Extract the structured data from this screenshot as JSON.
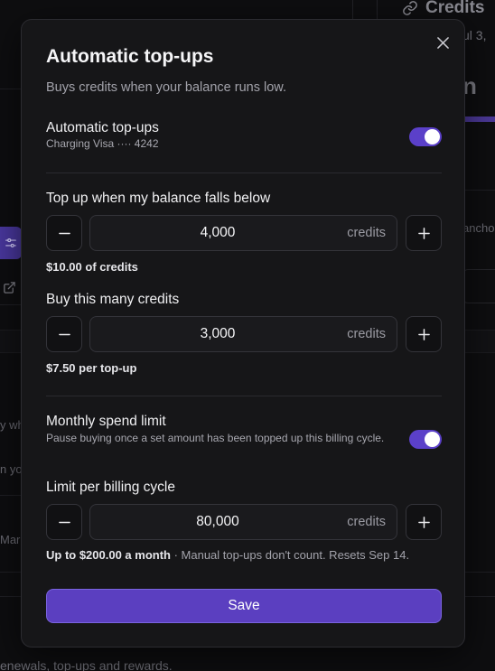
{
  "background": {
    "credits_heading": "Credits",
    "date_fragment": "ul 3,",
    "big_fragment": "n",
    "anchor_fragment": "ancho",
    "left_fragment_1": "y wh",
    "left_fragment_2": "n yo",
    "left_fragment_3": "Mar",
    "bottom_text": "enewals, top-ups and rewards."
  },
  "modal": {
    "title": "Automatic top-ups",
    "subtitle": "Buys credits when your balance runs low.",
    "auto_topups": {
      "label": "Automatic top-ups",
      "sublabel": "Charging Visa ···· 4242",
      "enabled": true
    },
    "threshold": {
      "label": "Top up when my balance falls below",
      "value": "4,000",
      "unit": "credits",
      "helper": "$10.00 of credits"
    },
    "purchase": {
      "label": "Buy this many credits",
      "value": "3,000",
      "unit": "credits",
      "helper": "$7.50 per top-up"
    },
    "spend_limit": {
      "label": "Monthly spend limit",
      "sublabel": "Pause buying once a set amount has been topped up this billing cycle.",
      "enabled": true
    },
    "cycle_limit": {
      "label": "Limit per billing cycle",
      "value": "80,000",
      "unit": "credits",
      "helper_strong": "Up to $200.00 a month",
      "helper_muted": " · Manual top-ups don't count. Resets Sep 14."
    },
    "save_label": "Save"
  },
  "colors": {
    "accent": "#5b40c9",
    "modal_bg": "#161618",
    "page_bg": "#0e0e10"
  }
}
